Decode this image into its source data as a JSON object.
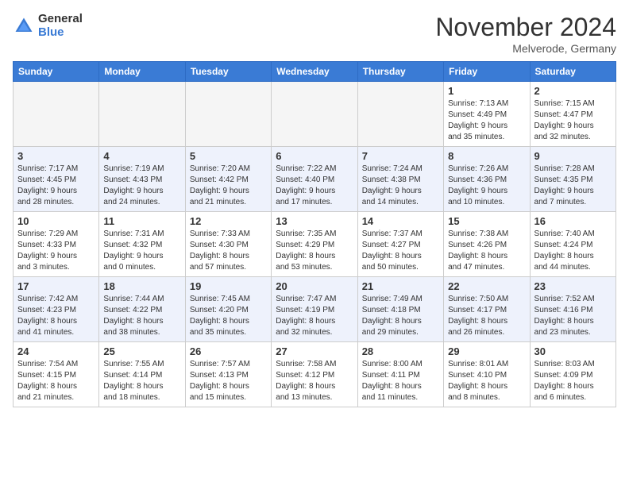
{
  "header": {
    "logo_general": "General",
    "logo_blue": "Blue",
    "month_title": "November 2024",
    "location": "Melverode, Germany"
  },
  "weekdays": [
    "Sunday",
    "Monday",
    "Tuesday",
    "Wednesday",
    "Thursday",
    "Friday",
    "Saturday"
  ],
  "weeks": [
    [
      {
        "day": "",
        "info": ""
      },
      {
        "day": "",
        "info": ""
      },
      {
        "day": "",
        "info": ""
      },
      {
        "day": "",
        "info": ""
      },
      {
        "day": "",
        "info": ""
      },
      {
        "day": "1",
        "info": "Sunrise: 7:13 AM\nSunset: 4:49 PM\nDaylight: 9 hours\nand 35 minutes."
      },
      {
        "day": "2",
        "info": "Sunrise: 7:15 AM\nSunset: 4:47 PM\nDaylight: 9 hours\nand 32 minutes."
      }
    ],
    [
      {
        "day": "3",
        "info": "Sunrise: 7:17 AM\nSunset: 4:45 PM\nDaylight: 9 hours\nand 28 minutes."
      },
      {
        "day": "4",
        "info": "Sunrise: 7:19 AM\nSunset: 4:43 PM\nDaylight: 9 hours\nand 24 minutes."
      },
      {
        "day": "5",
        "info": "Sunrise: 7:20 AM\nSunset: 4:42 PM\nDaylight: 9 hours\nand 21 minutes."
      },
      {
        "day": "6",
        "info": "Sunrise: 7:22 AM\nSunset: 4:40 PM\nDaylight: 9 hours\nand 17 minutes."
      },
      {
        "day": "7",
        "info": "Sunrise: 7:24 AM\nSunset: 4:38 PM\nDaylight: 9 hours\nand 14 minutes."
      },
      {
        "day": "8",
        "info": "Sunrise: 7:26 AM\nSunset: 4:36 PM\nDaylight: 9 hours\nand 10 minutes."
      },
      {
        "day": "9",
        "info": "Sunrise: 7:28 AM\nSunset: 4:35 PM\nDaylight: 9 hours\nand 7 minutes."
      }
    ],
    [
      {
        "day": "10",
        "info": "Sunrise: 7:29 AM\nSunset: 4:33 PM\nDaylight: 9 hours\nand 3 minutes."
      },
      {
        "day": "11",
        "info": "Sunrise: 7:31 AM\nSunset: 4:32 PM\nDaylight: 9 hours\nand 0 minutes."
      },
      {
        "day": "12",
        "info": "Sunrise: 7:33 AM\nSunset: 4:30 PM\nDaylight: 8 hours\nand 57 minutes."
      },
      {
        "day": "13",
        "info": "Sunrise: 7:35 AM\nSunset: 4:29 PM\nDaylight: 8 hours\nand 53 minutes."
      },
      {
        "day": "14",
        "info": "Sunrise: 7:37 AM\nSunset: 4:27 PM\nDaylight: 8 hours\nand 50 minutes."
      },
      {
        "day": "15",
        "info": "Sunrise: 7:38 AM\nSunset: 4:26 PM\nDaylight: 8 hours\nand 47 minutes."
      },
      {
        "day": "16",
        "info": "Sunrise: 7:40 AM\nSunset: 4:24 PM\nDaylight: 8 hours\nand 44 minutes."
      }
    ],
    [
      {
        "day": "17",
        "info": "Sunrise: 7:42 AM\nSunset: 4:23 PM\nDaylight: 8 hours\nand 41 minutes."
      },
      {
        "day": "18",
        "info": "Sunrise: 7:44 AM\nSunset: 4:22 PM\nDaylight: 8 hours\nand 38 minutes."
      },
      {
        "day": "19",
        "info": "Sunrise: 7:45 AM\nSunset: 4:20 PM\nDaylight: 8 hours\nand 35 minutes."
      },
      {
        "day": "20",
        "info": "Sunrise: 7:47 AM\nSunset: 4:19 PM\nDaylight: 8 hours\nand 32 minutes."
      },
      {
        "day": "21",
        "info": "Sunrise: 7:49 AM\nSunset: 4:18 PM\nDaylight: 8 hours\nand 29 minutes."
      },
      {
        "day": "22",
        "info": "Sunrise: 7:50 AM\nSunset: 4:17 PM\nDaylight: 8 hours\nand 26 minutes."
      },
      {
        "day": "23",
        "info": "Sunrise: 7:52 AM\nSunset: 4:16 PM\nDaylight: 8 hours\nand 23 minutes."
      }
    ],
    [
      {
        "day": "24",
        "info": "Sunrise: 7:54 AM\nSunset: 4:15 PM\nDaylight: 8 hours\nand 21 minutes."
      },
      {
        "day": "25",
        "info": "Sunrise: 7:55 AM\nSunset: 4:14 PM\nDaylight: 8 hours\nand 18 minutes."
      },
      {
        "day": "26",
        "info": "Sunrise: 7:57 AM\nSunset: 4:13 PM\nDaylight: 8 hours\nand 15 minutes."
      },
      {
        "day": "27",
        "info": "Sunrise: 7:58 AM\nSunset: 4:12 PM\nDaylight: 8 hours\nand 13 minutes."
      },
      {
        "day": "28",
        "info": "Sunrise: 8:00 AM\nSunset: 4:11 PM\nDaylight: 8 hours\nand 11 minutes."
      },
      {
        "day": "29",
        "info": "Sunrise: 8:01 AM\nSunset: 4:10 PM\nDaylight: 8 hours\nand 8 minutes."
      },
      {
        "day": "30",
        "info": "Sunrise: 8:03 AM\nSunset: 4:09 PM\nDaylight: 8 hours\nand 6 minutes."
      }
    ]
  ]
}
